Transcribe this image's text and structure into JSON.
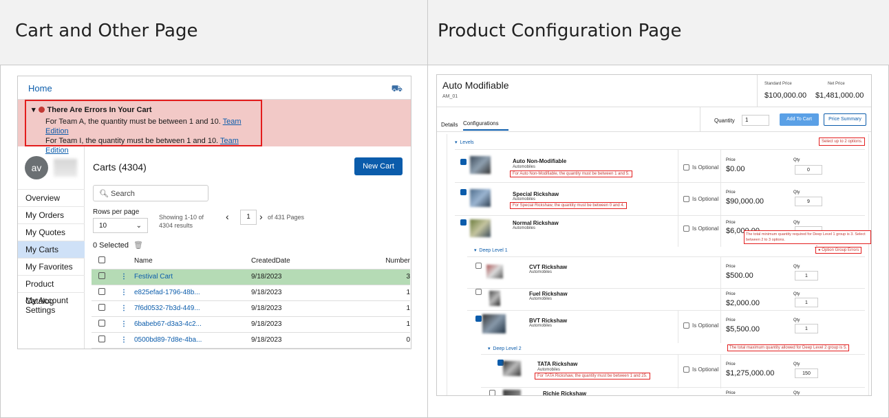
{
  "headers": {
    "left": "Cart and Other Page",
    "right": "Product Configuration Page"
  },
  "cart": {
    "home": "Home",
    "error_title": "There Are Errors In Your Cart",
    "errors": [
      {
        "text": "For Team A, the quantity must be between 1 and 10.",
        "link": "Team Edition"
      },
      {
        "text": "For Team I, the quantity must be between 1 and 10.",
        "link": "Team Edition"
      }
    ],
    "avatar": "av",
    "nav": [
      "Overview",
      "My Orders",
      "My Quotes",
      "My Carts",
      "My Favorites",
      "Product Catalog",
      "My Account Settings"
    ],
    "title": "Carts (4304)",
    "new_cart": "New Cart",
    "search_placeholder": "Search",
    "rows_per_page_label": "Rows per page",
    "rows_per_page": "10",
    "showing": "Showing 1-10 of 4304 results",
    "page": "1",
    "of_pages": "of 431 Pages",
    "selected": "0 Selected",
    "columns": [
      "Name",
      "CreatedDate",
      "Number"
    ],
    "rows": [
      {
        "name": "Festival Cart",
        "date": "9/18/2023",
        "num": "3"
      },
      {
        "name": "e825efad-1796-48b...",
        "date": "9/18/2023",
        "num": "1"
      },
      {
        "name": "7f6d0532-7b3d-449...",
        "date": "9/18/2023",
        "num": "1"
      },
      {
        "name": "6babeb67-d3a3-4c2...",
        "date": "9/18/2023",
        "num": "1"
      },
      {
        "name": "0500bd89-7d8e-4ba...",
        "date": "9/18/2023",
        "num": "0"
      }
    ]
  },
  "config": {
    "title": "Auto Modifiable",
    "code": "AM_01",
    "std_price_label": "Standard Price",
    "std_price": "$100,000.00",
    "net_price_label": "Net Price",
    "net_price": "$1,481,000.00",
    "tabs": [
      "Details",
      "Configurations"
    ],
    "quantity_label": "Quantity",
    "quantity": "1",
    "add_to_cart": "Add To Cart",
    "price_summary": "Price Summary",
    "levels": "Levels",
    "select_up_to": "Select up to 2 options.",
    "price_label": "Price",
    "qty_label": "Qty",
    "is_optional": "Is Optional",
    "category": "Automobiles",
    "items": [
      {
        "name": "Auto Non-Modifiable",
        "price": "$0.00",
        "qty": "0",
        "err": "For Auto Non-Modifiable, the quantity must be between 1 and 5."
      },
      {
        "name": "Special Rickshaw",
        "price": "$90,000.00",
        "qty": "9",
        "err": "For Special Rickshaw, the quantity must be between 0 and 4."
      },
      {
        "name": "Normal Rickshaw",
        "price": "$6,000.00",
        "qty": "",
        "err": ""
      }
    ],
    "tooltip": "The total minimum quantity required for Deep Level 1 group is 3. Select between 2 to 3 options.",
    "deep1": "Deep Level 1",
    "option_group_errors": "Option Group Errors",
    "deep_items": [
      {
        "name": "CVT Rickshaw",
        "price": "$500.00",
        "qty": "1"
      },
      {
        "name": "Fuel Rickshaw",
        "price": "$2,000.00",
        "qty": "1"
      },
      {
        "name": "BVT Rickshaw",
        "price": "$5,500.00",
        "qty": "1"
      }
    ],
    "deep2": "Deep Level 2",
    "deep2_err": "The total maximum quantity allowed for Deep Level 2 group is 5.",
    "tata": {
      "name": "TATA Rickshaw",
      "price": "$1,275,000.00",
      "qty": "150",
      "err": "For TATA Rickshaw, the quantity must be between 1 and 25."
    },
    "richie": "Richie Rickshaw"
  }
}
